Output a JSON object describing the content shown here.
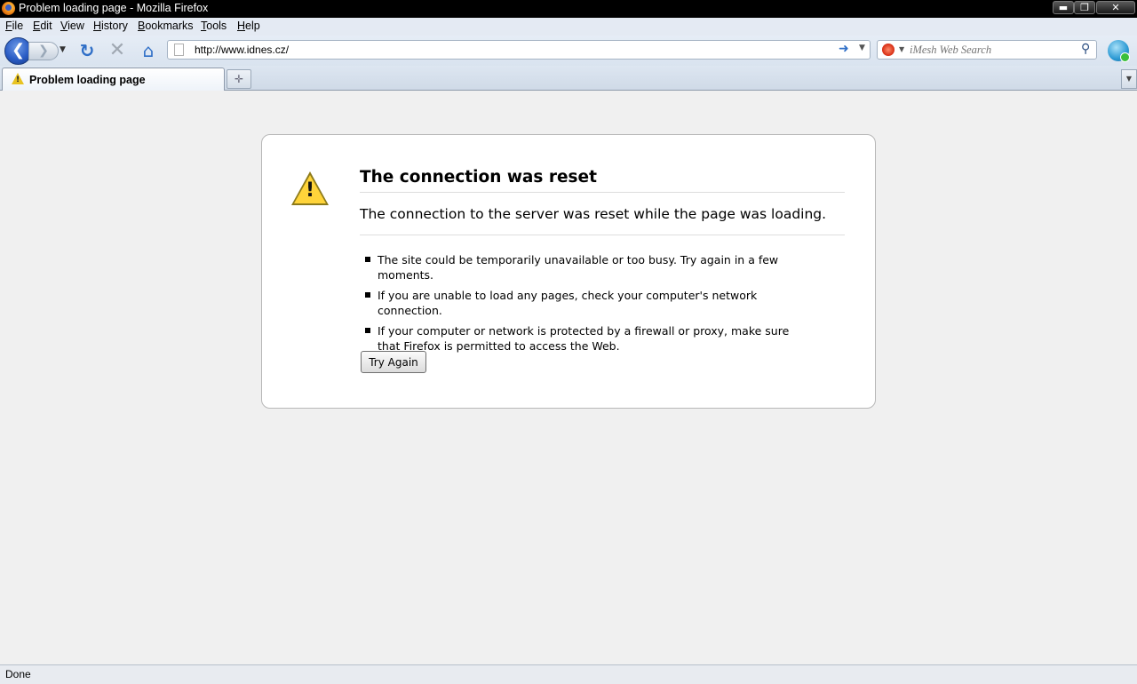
{
  "window": {
    "title": "Problem loading page - Mozilla Firefox",
    "controls": {
      "minimize": "▬",
      "maximize": "❐",
      "close": "✕"
    }
  },
  "menubar": {
    "items": [
      {
        "first": "F",
        "rest": "ile"
      },
      {
        "first": "E",
        "rest": "dit"
      },
      {
        "first": "V",
        "rest": "iew"
      },
      {
        "first": "H",
        "rest": "istory"
      },
      {
        "first": "B",
        "rest": "ookmarks"
      },
      {
        "first": "T",
        "rest": "ools"
      },
      {
        "first": "H",
        "rest": "elp"
      }
    ]
  },
  "navbar": {
    "url": "http://www.idnes.cz/",
    "search_placeholder": "iMesh Web Search"
  },
  "tabs": [
    {
      "label": "Problem loading page",
      "icon": "warning-icon"
    }
  ],
  "error": {
    "title": "The connection was reset",
    "description": "The connection to the server was reset while the page was loading.",
    "items": [
      "The site could be temporarily unavailable or too busy. Try again in a few moments.",
      "If you are unable to load any pages, check your computer's network connection.",
      "If your computer or network is protected by a firewall or proxy, make sure that Firefox is permitted to access the Web."
    ],
    "button": "Try Again"
  },
  "status": {
    "text": "Done"
  },
  "colors": {
    "titlebar": "#000000",
    "menubar": "#e4eaf3",
    "content_bg": "#f0f0f0",
    "warning_yellow": "#ffd43a"
  }
}
